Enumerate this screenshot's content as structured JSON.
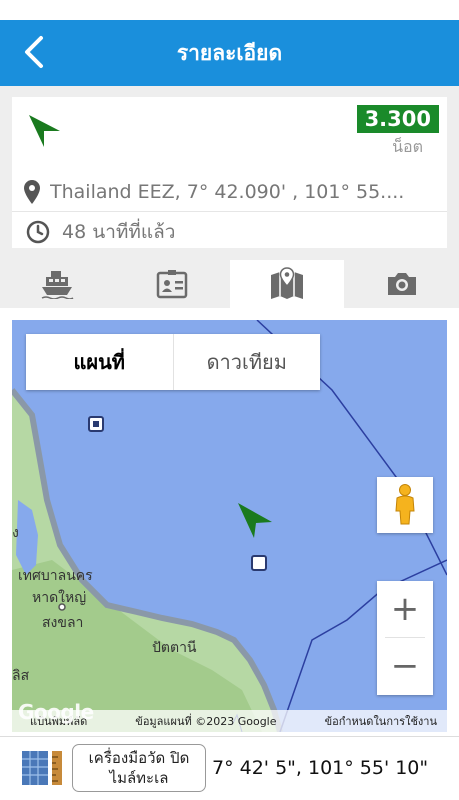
{
  "header": {
    "title": "รายละเอียด"
  },
  "vessel": {
    "speed": "3.300",
    "speed_unit": "น็อต",
    "location": "Thailand EEZ, 7° 42.090' , 101° 55....",
    "last_seen": "48 นาทีที่แล้ว",
    "arrow_color": "#1a7a1f",
    "speed_badge_color": "#1a8a2a"
  },
  "tabs": [
    {
      "icon": "ship-icon",
      "active": false
    },
    {
      "icon": "id-card-icon",
      "active": false
    },
    {
      "icon": "map-icon",
      "active": true
    },
    {
      "icon": "camera-icon",
      "active": false
    }
  ],
  "map": {
    "type_map": "แผนที่",
    "type_satellite": "ดาวเทียม",
    "zoom_in": "+",
    "zoom_out": "−",
    "place_labels": [
      "เทศบาลนคร",
      "หาดใหญ่",
      "สงขลา",
      "ปัตตานี",
      "ลิส",
      "ง"
    ],
    "logo": "Google",
    "footer_shortcuts": "แป้นพิมพ์ลัด",
    "footer_data": "ข้อมูลแผนที่ ©2023 Google",
    "footer_terms": "ข้อกำหนดในการใช้งาน"
  },
  "bottom": {
    "measure_label": "เครื่องมือวัด ปิด",
    "measure_unit": "ไมล์ทะเล",
    "coords": "7° 42' 5\", 101° 55' 10\""
  }
}
